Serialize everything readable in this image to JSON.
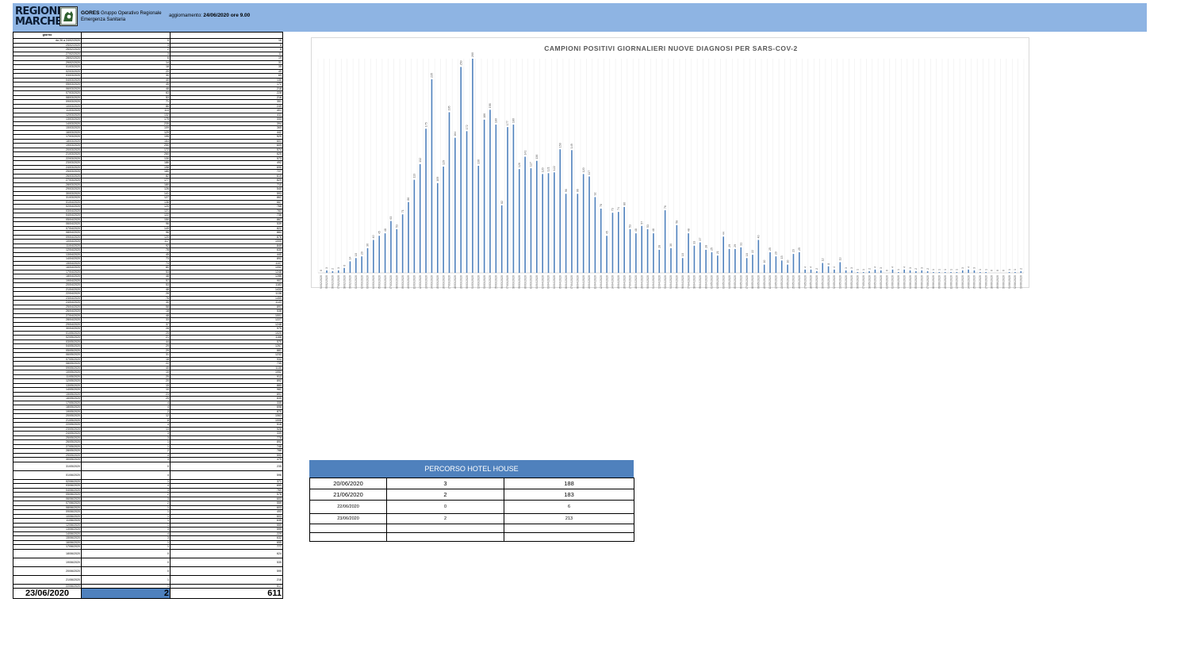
{
  "header": {
    "logo_line1": "REGIONE",
    "logo_line2": "MARCHE",
    "gores_abbr": "GORES",
    "gores_line1": "Gruppo Operativo Regionale",
    "gores_line2": "Emergenza Sanitaria",
    "update_prefix": "aggiornamento: ",
    "update_value": "24/06/2020 ore 9.00",
    "banner_color": "#8eb4e3"
  },
  "daily_table": {
    "col_headers": [
      "giorno",
      "",
      ""
    ],
    "rows": [
      [
        "da 26 a 24/02/2020",
        "0",
        "16"
      ],
      [
        "25/02/2020",
        "3",
        "8"
      ],
      [
        "26/02/2020",
        "2",
        "8"
      ],
      [
        "27/02/2020",
        "3",
        "11"
      ],
      [
        "28/02/2020",
        "6",
        "19"
      ],
      [
        "29/02/2020",
        "14",
        "31"
      ],
      [
        "01/03/2020",
        "18",
        "35"
      ],
      [
        "02/03/2020",
        "20",
        "49"
      ],
      [
        "03/03/2020",
        "30",
        "69"
      ],
      [
        "04/03/2020",
        "40",
        "130"
      ],
      [
        "05/03/2020",
        "45",
        "172"
      ],
      [
        "06/03/2020",
        "48",
        "218"
      ],
      [
        "07/03/2020",
        "63",
        "228"
      ],
      [
        "08/03/2020",
        "53",
        "216"
      ],
      [
        "09/03/2020",
        "71",
        "351"
      ],
      [
        "10/03/2020",
        "86",
        "249"
      ],
      [
        "11/03/2020",
        "113",
        "401"
      ],
      [
        "12/03/2020",
        "132",
        "411"
      ],
      [
        "13/03/2020",
        "175",
        "333"
      ],
      [
        "14/03/2020",
        "235",
        "394"
      ],
      [
        "15/03/2020",
        "109",
        "365"
      ],
      [
        "16/03/2020",
        "129",
        "442"
      ],
      [
        "17/03/2020",
        "195",
        "520"
      ],
      [
        "18/03/2020",
        "164",
        "601"
      ],
      [
        "19/03/2020",
        "250",
        "609"
      ],
      [
        "20/03/2020",
        "172",
        "574"
      ],
      [
        "21/03/2020",
        "260",
        "625"
      ],
      [
        "22/03/2020",
        "130",
        "573"
      ],
      [
        "23/03/2020",
        "186",
        "492"
      ],
      [
        "24/03/2020",
        "198",
        "690"
      ],
      [
        "25/03/2020",
        "180",
        "727"
      ],
      [
        "26/03/2020",
        "82",
        "619"
      ],
      [
        "27/03/2020",
        "177",
        "829"
      ],
      [
        "28/03/2020",
        "180",
        "710"
      ],
      [
        "29/03/2020",
        "126",
        "540"
      ],
      [
        "30/03/2020",
        "141",
        "593"
      ],
      [
        "31/03/2020",
        "127",
        "862"
      ],
      [
        "01/04/2020",
        "136",
        "667"
      ],
      [
        "02/04/2020",
        "120",
        "768"
      ],
      [
        "03/04/2020",
        "121",
        "783"
      ],
      [
        "04/04/2020",
        "122",
        "736"
      ],
      [
        "05/04/2020",
        "150",
        "867"
      ],
      [
        "06/04/2020",
        "96",
        "539"
      ],
      [
        "07/04/2020",
        "149",
        "822"
      ],
      [
        "08/04/2020",
        "96",
        "884"
      ],
      [
        "09/04/2020",
        "120",
        "876"
      ],
      [
        "10/04/2020",
        "117",
        "1000"
      ],
      [
        "11/04/2020",
        "92",
        "849"
      ],
      [
        "12/04/2020",
        "78",
        "630"
      ],
      [
        "13/04/2020",
        "45",
        "440"
      ],
      [
        "14/04/2020",
        "73",
        "892"
      ],
      [
        "15/04/2020",
        "74",
        "1107"
      ],
      [
        "16/04/2020",
        "80",
        "1052"
      ],
      [
        "17/04/2020",
        "53",
        "1248"
      ],
      [
        "18/04/2020",
        "48",
        "1286"
      ],
      [
        "19/04/2020",
        "57",
        "907"
      ],
      [
        "20/04/2020",
        "53",
        "1183"
      ],
      [
        "21/04/2020",
        "48",
        "1433"
      ],
      [
        "22/04/2020",
        "28",
        "1138"
      ],
      [
        "23/04/2020",
        "76",
        "1459"
      ],
      [
        "24/04/2020",
        "30",
        "1143"
      ],
      [
        "25/04/2020",
        "58",
        "891"
      ],
      [
        "26/04/2020",
        "18",
        "538"
      ],
      [
        "27/04/2020",
        "48",
        "1001"
      ],
      [
        "28/04/2020",
        "33",
        "1227"
      ],
      [
        "29/04/2020",
        "37",
        "1248"
      ],
      [
        "30/04/2020",
        "28",
        "979"
      ],
      [
        "01/05/2020",
        "25",
        "1020"
      ],
      [
        "02/05/2020",
        "21",
        "1168"
      ],
      [
        "03/05/2020",
        "44",
        "570"
      ],
      [
        "04/05/2020",
        "29",
        "1267"
      ],
      [
        "05/05/2020",
        "29",
        "881"
      ],
      [
        "06/05/2020",
        "31",
        "1232"
      ],
      [
        "07/05/2020",
        "18",
        "934"
      ],
      [
        "08/05/2020",
        "22",
        "735"
      ],
      [
        "09/05/2020",
        "40",
        "1130"
      ],
      [
        "10/05/2020",
        "10",
        "1052"
      ],
      [
        "11/05/2020",
        "25",
        "912"
      ],
      [
        "12/05/2020",
        "20",
        "892"
      ],
      [
        "13/05/2020",
        "15",
        "889"
      ],
      [
        "14/05/2020",
        "10",
        "982"
      ],
      [
        "15/05/2020",
        "23",
        "891"
      ],
      [
        "16/05/2020",
        "25",
        "835"
      ],
      [
        "17/05/2020",
        "4",
        "335"
      ],
      [
        "18/05/2020",
        "4",
        "698"
      ],
      [
        "19/05/2020",
        "2",
        "870"
      ],
      [
        "20/05/2020",
        "12",
        "1063"
      ],
      [
        "21/05/2020",
        "8",
        "1006"
      ],
      [
        "22/05/2020",
        "4",
        "518"
      ],
      [
        "23/05/2020",
        "13",
        "528"
      ],
      [
        "24/05/2020",
        "3",
        "339"
      ],
      [
        "25/05/2020",
        "3",
        "778"
      ],
      [
        "26/05/2020",
        "1",
        "892"
      ],
      [
        "27/05/2020",
        "1",
        "746"
      ],
      [
        "28/05/2020",
        "2",
        "788"
      ],
      [
        "29/05/2020",
        "4",
        "590"
      ],
      [
        "30/05/2020",
        "3",
        "479"
      ],
      [
        "31/05/2020",
        "0",
        "235"
      ],
      [
        "01/06/2020",
        "4",
        "596"
      ],
      [
        "02/06/2020",
        "1",
        "371"
      ],
      [
        "03/06/2020",
        "4",
        "659"
      ],
      [
        "04/06/2020",
        "3",
        "769"
      ],
      [
        "05/06/2020",
        "2",
        "578"
      ],
      [
        "06/06/2020",
        "3",
        "603"
      ],
      [
        "07/06/2020",
        "2",
        "559"
      ],
      [
        "08/06/2020",
        "1",
        "603"
      ],
      [
        "09/06/2020",
        "1",
        "493"
      ],
      [
        "10/06/2020",
        "1",
        "603"
      ],
      [
        "11/06/2020",
        "1",
        "639"
      ],
      [
        "12/06/2020",
        "1",
        "559"
      ],
      [
        "13/06/2020",
        "3",
        "599"
      ],
      [
        "14/06/2020",
        "4",
        "229"
      ],
      [
        "15/06/2020",
        "3",
        "632"
      ],
      [
        "16/06/2020",
        "1",
        "655"
      ],
      [
        "17/06/2020",
        "1",
        "777"
      ],
      [
        "18/06/2020",
        "0",
        "624"
      ],
      [
        "19/06/2020",
        "0",
        "539"
      ],
      [
        "20/06/2020",
        "0",
        "599"
      ],
      [
        "21/06/2020",
        "1",
        "216"
      ],
      [
        "22/06/2020",
        "1",
        "517"
      ]
    ],
    "total": {
      "date": "23/06/2020",
      "new_cases": "2",
      "tests": "611"
    },
    "highlight_color": "#4f81bd"
  },
  "hotel": {
    "title": "PERCORSO HOTEL HOUSE",
    "rows": [
      [
        "20/06/2020",
        "3",
        "188"
      ],
      [
        "21/06/2020",
        "2",
        "183"
      ],
      [
        "22/06/2020",
        "0",
        "6"
      ],
      [
        "23/06/2020",
        "2",
        "213"
      ],
      [
        "",
        "",
        ""
      ],
      [
        "",
        "",
        ""
      ]
    ],
    "header_color": "#4f81bd"
  },
  "chart_data": {
    "type": "bar",
    "title": "CAMPIONI POSITIVI GIORNALIERI NUOVE DIAGNOSI PER SARS-COV-2",
    "xlabel": "",
    "ylabel": "",
    "ylim": [
      0,
      260
    ],
    "grid": true,
    "legend": "none",
    "bar_color": "#4f81bd",
    "categories": [
      "DA 26 A 24/02/2020",
      "25/02/2020",
      "26/02/2020",
      "27/02/2020",
      "28/02/2020",
      "29/02/2020",
      "01/03/2020",
      "02/03/2020",
      "03/03/2020",
      "04/03/2020",
      "05/03/2020",
      "06/03/2020",
      "07/03/2020",
      "08/03/2020",
      "09/03/2020",
      "10/03/2020",
      "11/03/2020",
      "12/03/2020",
      "13/03/2020",
      "14/03/2020",
      "15/03/2020",
      "16/03/2020",
      "17/03/2020",
      "18/03/2020",
      "19/03/2020",
      "20/03/2020",
      "21/03/2020",
      "22/03/2020",
      "23/03/2020",
      "24/03/2020",
      "25/03/2020",
      "26/03/2020",
      "27/03/2020",
      "28/03/2020",
      "29/03/2020",
      "30/03/2020",
      "31/03/2020",
      "01/04/2020",
      "02/04/2020",
      "03/04/2020",
      "04/04/2020",
      "05/04/2020",
      "06/04/2020",
      "07/04/2020",
      "08/04/2020",
      "09/04/2020",
      "10/04/2020",
      "11/04/2020",
      "12/04/2020",
      "13/04/2020",
      "14/04/2020",
      "15/04/2020",
      "16/04/2020",
      "17/04/2020",
      "18/04/2020",
      "19/04/2020",
      "20/04/2020",
      "21/04/2020",
      "22/04/2020",
      "23/04/2020",
      "24/04/2020",
      "25/04/2020",
      "26/04/2020",
      "27/04/2020",
      "28/04/2020",
      "29/04/2020",
      "30/04/2020",
      "01/05/2020",
      "02/05/2020",
      "03/05/2020",
      "04/05/2020",
      "05/05/2020",
      "06/05/2020",
      "07/05/2020",
      "08/05/2020",
      "09/05/2020",
      "10/05/2020",
      "11/05/2020",
      "12/05/2020",
      "13/05/2020",
      "14/05/2020",
      "15/05/2020",
      "16/05/2020",
      "17/05/2020",
      "18/05/2020",
      "19/05/2020",
      "20/05/2020",
      "21/05/2020",
      "22/05/2020",
      "23/05/2020",
      "24/05/2020",
      "25/05/2020",
      "26/05/2020",
      "27/05/2020",
      "28/05/2020",
      "29/05/2020",
      "30/05/2020",
      "31/05/2020",
      "01/06/2020",
      "02/06/2020",
      "03/06/2020",
      "04/06/2020",
      "05/06/2020",
      "06/06/2020",
      "07/06/2020",
      "08/06/2020",
      "09/06/2020",
      "10/06/2020",
      "11/06/2020",
      "12/06/2020",
      "13/06/2020",
      "14/06/2020",
      "15/06/2020",
      "16/06/2020",
      "17/06/2020",
      "18/06/2020",
      "19/06/2020",
      "20/06/2020",
      "21/06/2020",
      "22/06/2020",
      "23/06/2020"
    ],
    "values": [
      0,
      3,
      2,
      3,
      6,
      14,
      18,
      20,
      30,
      40,
      45,
      48,
      63,
      53,
      71,
      86,
      113,
      132,
      175,
      235,
      109,
      129,
      195,
      164,
      250,
      172,
      260,
      130,
      186,
      198,
      180,
      82,
      177,
      180,
      126,
      141,
      127,
      136,
      120,
      121,
      122,
      150,
      96,
      149,
      96,
      120,
      117,
      92,
      78,
      45,
      73,
      74,
      80,
      53,
      48,
      57,
      53,
      48,
      28,
      76,
      30,
      58,
      18,
      48,
      33,
      37,
      28,
      25,
      21,
      44,
      29,
      29,
      31,
      18,
      22,
      40,
      10,
      25,
      20,
      15,
      10,
      23,
      25,
      4,
      4,
      2,
      12,
      8,
      4,
      13,
      3,
      3,
      1,
      1,
      2,
      4,
      3,
      0,
      4,
      1,
      4,
      3,
      2,
      3,
      2,
      1,
      1,
      1,
      1,
      1,
      3,
      4,
      3,
      1,
      1,
      0,
      0,
      0,
      1,
      1,
      2
    ]
  }
}
